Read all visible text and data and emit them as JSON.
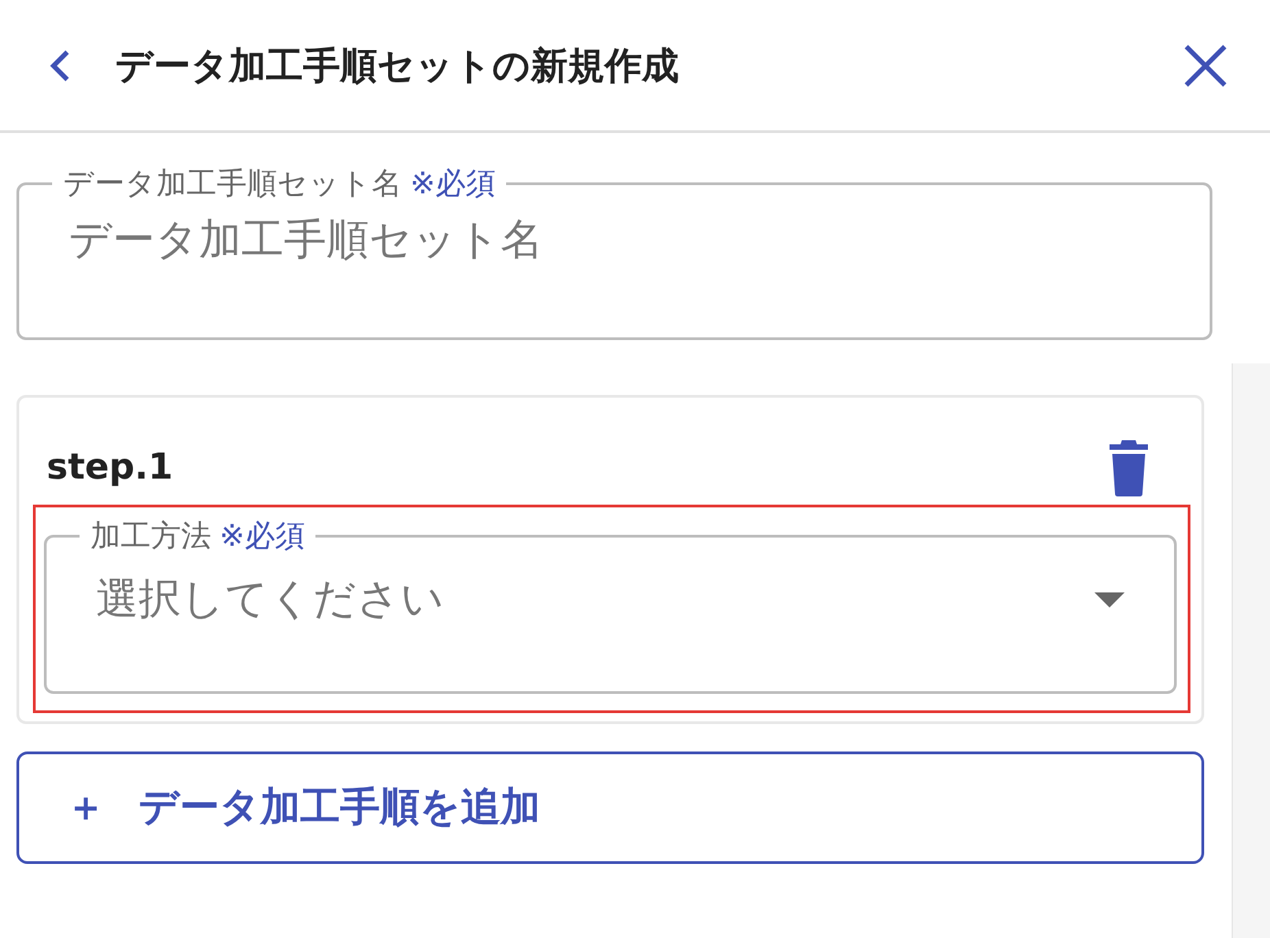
{
  "header": {
    "title": "データ加工手順セットの新規作成"
  },
  "name_field": {
    "label": "データ加工手順セット名",
    "required_mark": "※必須",
    "placeholder": "データ加工手順セット名"
  },
  "steps": [
    {
      "title": "step.1",
      "method_field": {
        "label": "加工方法",
        "required_mark": "※必須",
        "placeholder": "選択してください",
        "highlighted": true
      }
    }
  ],
  "add_button": {
    "icon": "＋",
    "label": "データ加工手順を追加"
  }
}
